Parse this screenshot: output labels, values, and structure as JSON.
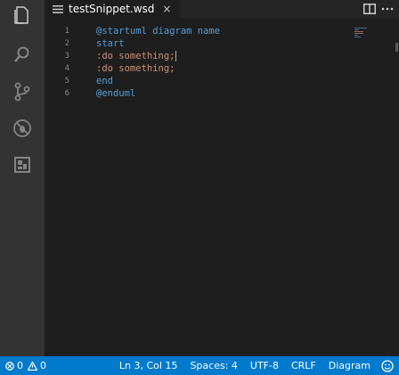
{
  "tab": {
    "filename": "testSnippet.wsd",
    "close_glyph": "×"
  },
  "editor": {
    "lines": [
      {
        "n": "1",
        "text": "@startuml diagram name",
        "kind": "keyword"
      },
      {
        "n": "2",
        "text": "start",
        "kind": "keyword"
      },
      {
        "n": "3",
        "text": ":do something;",
        "kind": "string"
      },
      {
        "n": "4",
        "text": ":do something;",
        "kind": "string"
      },
      {
        "n": "5",
        "text": "end",
        "kind": "keyword"
      },
      {
        "n": "6",
        "text": "@enduml",
        "kind": "keyword"
      }
    ]
  },
  "status": {
    "errors": "0",
    "warnings": "0",
    "position": "Ln 3, Col 15",
    "indent": "Spaces: 4",
    "encoding": "UTF-8",
    "eol": "CRLF",
    "language": "Diagram"
  },
  "colors": {
    "activity_bar": "#333333",
    "editor_bg": "#1e1e1e",
    "status_bar": "#007acc",
    "keyword": "#569cd6",
    "string": "#ce9178"
  },
  "icons": {
    "activity": [
      "explorer-icon",
      "search-icon",
      "source-control-icon",
      "debug-icon",
      "extensions-icon"
    ],
    "tab_actions": [
      "split-editor-icon",
      "more-actions-icon"
    ]
  }
}
